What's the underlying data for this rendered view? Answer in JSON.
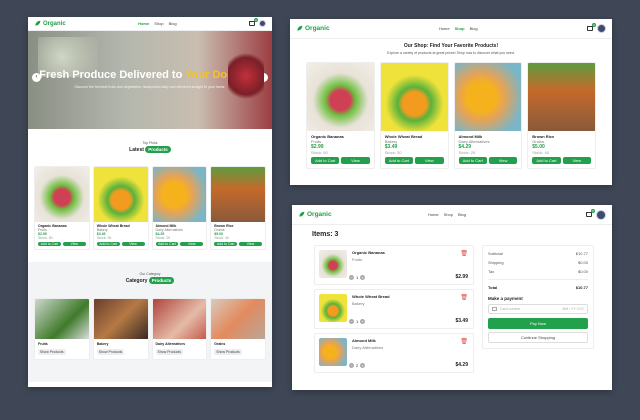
{
  "brand": {
    "name": "Organic",
    "accent": "#22a04b"
  },
  "nav": {
    "home": "Home",
    "shop": "Shop",
    "blog": "Blog",
    "cart_count": "0"
  },
  "home": {
    "hero": {
      "title_main": "Fresh Produce Delivered to",
      "title_highlight": "Your Doorstep",
      "subtitle": "Discover the freshest fruits and vegetables, handpicked daily and delivered straight to your home."
    },
    "latest": {
      "kicker": "Top Picks",
      "title": "Latest",
      "pill": "Products"
    },
    "products": [
      {
        "name": "Organic Bananas",
        "category": "Fruits",
        "price": "$2.99",
        "stock": "Stock: 50"
      },
      {
        "name": "Whole Wheat Bread",
        "category": "Bakery",
        "price": "$3.49",
        "stock": "Stock: 30"
      },
      {
        "name": "Almond Milk",
        "category": "Dairy Alternatives",
        "price": "$4.29",
        "stock": "Stock: 25"
      },
      {
        "name": "Brown Rice",
        "category": "Grains",
        "price": "$5.00",
        "stock": "Stock: 40"
      }
    ],
    "add_label": "Add to Cart",
    "view_label": "View",
    "category": {
      "kicker": "Our Category",
      "title": "Category",
      "pill": "Products"
    },
    "categories": [
      {
        "name": "Fruits",
        "button": "Show Products"
      },
      {
        "name": "Bakery",
        "button": "Show Products"
      },
      {
        "name": "Dairy Alternatives",
        "button": "Show Products"
      },
      {
        "name": "Grains",
        "button": "Show Products"
      }
    ]
  },
  "shop": {
    "title": "Our Shop: Find Your Favorite Products!",
    "subtitle": "Explore a variety of products at great prices! Shop now to discover what you need.",
    "products": [
      {
        "name": "Organic Bananas",
        "category": "Fruits",
        "price": "$2.99",
        "stock": "Stock: 50"
      },
      {
        "name": "Whole Wheat Bread",
        "category": "Bakery",
        "price": "$3.49",
        "stock": "Stock: 30"
      },
      {
        "name": "Almond Milk",
        "category": "Dairy Alternatives",
        "price": "$4.29",
        "stock": "Stock: 25"
      },
      {
        "name": "Brown Rice",
        "category": "Grains",
        "price": "$5.00",
        "stock": "Stock: 40"
      }
    ]
  },
  "cart": {
    "title": "Items: 3",
    "items": [
      {
        "name": "Organic Bananas",
        "category": "Fruits",
        "qty": "1",
        "price": "$2.99"
      },
      {
        "name": "Whole Wheat Bread",
        "category": "Bakery",
        "qty": "1",
        "price": "$3.49"
      },
      {
        "name": "Almond Milk",
        "category": "Dairy Alternatives",
        "qty": "2",
        "price": "$4.29"
      }
    ],
    "summary": {
      "subtotal_label": "Subtotal",
      "subtotal": "$10.77",
      "shipping_label": "Shipping",
      "shipping": "$0.00",
      "tax_label": "Tax",
      "tax": "$0.00",
      "total_label": "Total",
      "total": "$10.77",
      "payment_title": "Make a payment",
      "card_placeholder": "Card number",
      "expiry_placeholder": "MM / YY  CVC",
      "pay_label": "Pay Now",
      "continue_label": "Continue Shopping"
    }
  }
}
